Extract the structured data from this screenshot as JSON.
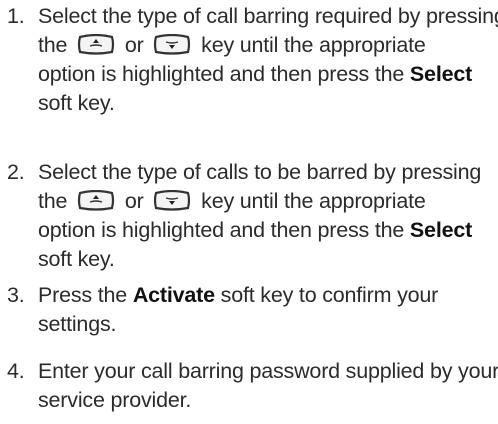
{
  "steps": [
    {
      "number": "1.",
      "line1": "Select the type of call barring required by pressing",
      "line2_pre": "the",
      "line2_or": "or",
      "line2_post": "key until the appropriate",
      "line3_pre": "option is highlighted and then press the",
      "line3_bold": "Select",
      "line4": "soft key."
    },
    {
      "number": "2.",
      "line1": "Select the type of calls to be barred by pressing",
      "line2_pre": "the",
      "line2_or": "or",
      "line2_post": "key until the appropriate",
      "line3_pre": "option is highlighted and then press the",
      "line3_bold": "Select",
      "line4": "soft key."
    },
    {
      "number": "3.",
      "line1_pre": "Press the",
      "line1_bold": "Activate",
      "line1_post": "soft key to confirm your",
      "line2": "settings."
    },
    {
      "number": "4.",
      "line1": "Enter your call barring password supplied by your",
      "line2": "service provider."
    }
  ],
  "icons": {
    "up": "up-key-icon",
    "down": "down-key-icon"
  },
  "colors": {
    "text": "#2b2b2b",
    "bold": "#111111",
    "key_fill": "#f4f4f4",
    "key_stroke": "#333333"
  }
}
